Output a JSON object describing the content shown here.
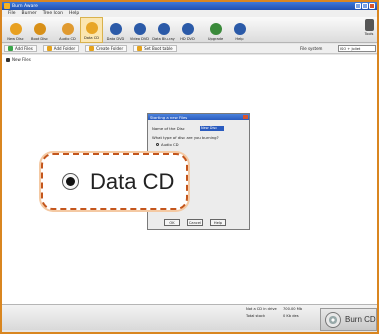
{
  "window": {
    "title": "Burn Aware"
  },
  "menubar": [
    "File",
    "Burner",
    "Tree Icon",
    "Help"
  ],
  "toolbar": {
    "buttons": [
      {
        "label": "New Disc",
        "icon": "new-disc-icon",
        "color": "#e8a020"
      },
      {
        "label": "Boot Disc",
        "icon": "boot-disc-icon",
        "color": "#d89018"
      },
      {
        "label": "Audio CD",
        "icon": "audio-cd-icon",
        "color": "#e09a30"
      },
      {
        "label": "Data CD",
        "icon": "data-cd-icon",
        "color": "#e8a626",
        "active": true
      },
      {
        "label": "Data DVD",
        "icon": "data-dvd-icon",
        "color": "#2b5aa8"
      },
      {
        "label": "Video DVD",
        "icon": "video-dvd-icon",
        "color": "#2b5aa8"
      },
      {
        "label": "Data Blu-ray",
        "icon": "data-bluray-icon",
        "color": "#2b5aa8"
      },
      {
        "label": "HD DVD",
        "icon": "hd-dvd-icon",
        "color": "#2b5aa8"
      },
      {
        "label": "Upgrade",
        "icon": "upgrade-icon",
        "color": "#3a8a3a"
      },
      {
        "label": "Help",
        "icon": "help-icon",
        "color": "#2b5aa8"
      }
    ],
    "right_button": {
      "label": "Tools",
      "icon": "tools-icon"
    }
  },
  "secondary_toolbar": {
    "buttons": [
      {
        "label": "Add Files",
        "icon": "add-files-icon"
      },
      {
        "label": "Add Folder",
        "icon": "add-folder-icon"
      },
      {
        "label": "Create Folder",
        "icon": "create-folder-icon"
      },
      {
        "label": "Set Boot table",
        "icon": "boot-table-icon"
      }
    ],
    "filesystem_label": "File system",
    "filesystem_value": "ISO + Joliet"
  },
  "tree": {
    "root_label": "New Files"
  },
  "dialog": {
    "title": "Starting a new Files",
    "name_label": "Name of the Disc",
    "name_value": "New Disc",
    "question": "What type of disc are you burning?",
    "options": [
      "Audio CD",
      "Data CD"
    ],
    "buttons": [
      "OK",
      "Cancel",
      "Help"
    ]
  },
  "callout": {
    "label": "Data CD",
    "selected": true
  },
  "status": {
    "drive_label": "Not a CD in drive",
    "total_label": "Total stock",
    "size_label": "700.00 Mb",
    "size_value": "0 Kb des"
  },
  "burn_button": {
    "label": "Burn CD",
    "icon": "burn-disc-icon"
  },
  "colors": {
    "frame": "#e39a2c",
    "callout_border": "#c4561c",
    "title_blue": "#1f4fb0"
  }
}
